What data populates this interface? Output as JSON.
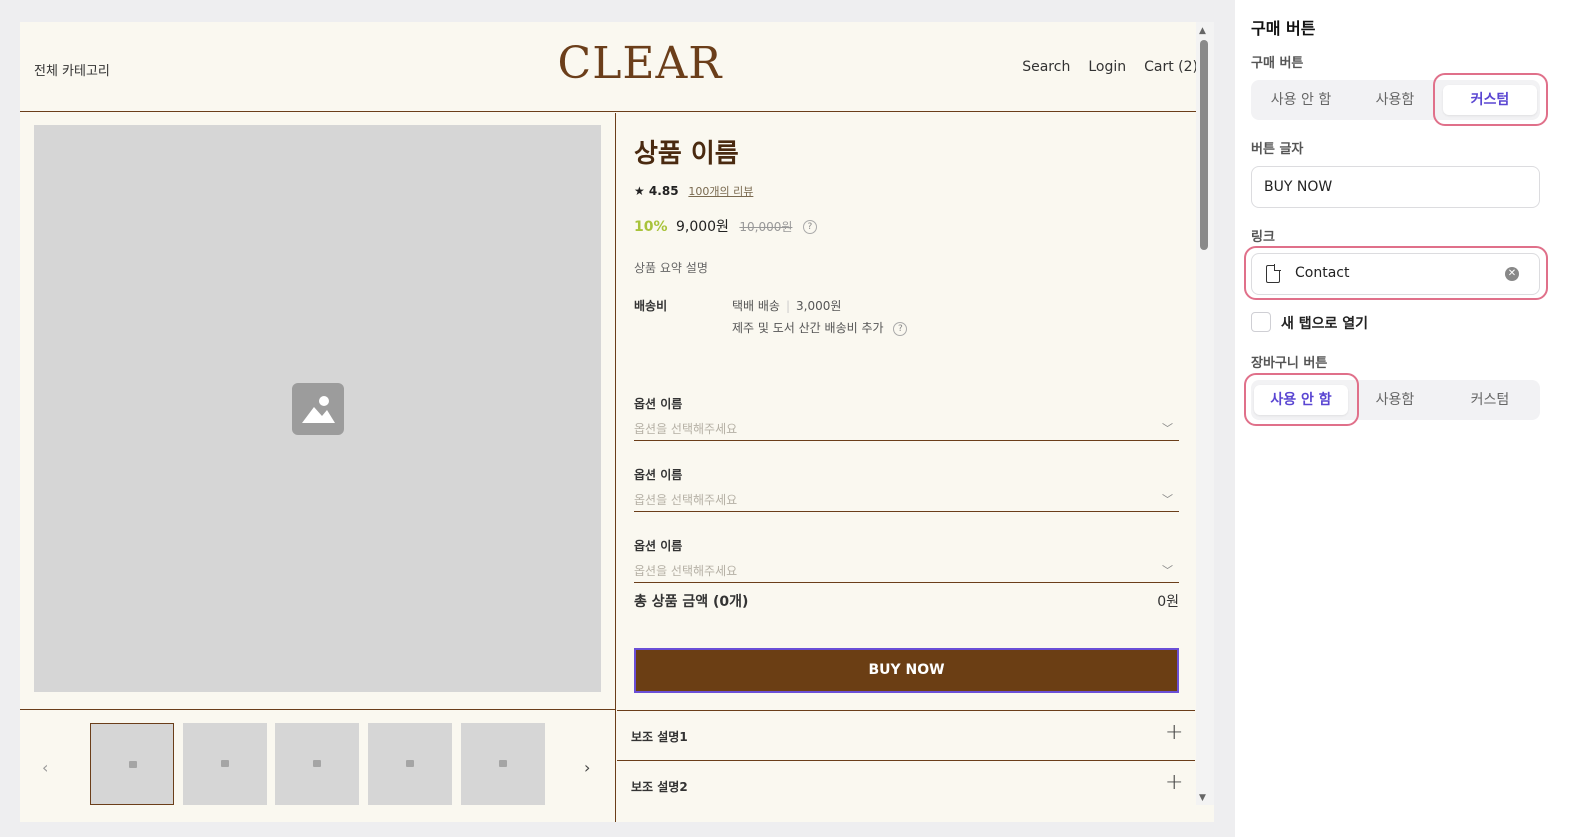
{
  "preview": {
    "header": {
      "category": "전체 카테고리",
      "logo": "CLEAR",
      "nav": [
        "Search",
        "Login",
        "Cart (2)"
      ]
    },
    "product": {
      "name": "상품 이름",
      "rating": "★ 4.85",
      "reviews": "100개의 리뷰",
      "discount": "10%",
      "price": "9,000원",
      "original_price": "10,000원",
      "summary": "상품 요약 설명",
      "shipping_label": "배송비",
      "shipping_method": "택배 배송",
      "shipping_fee": "3,000원",
      "shipping_extra": "제주 및 도서 산간 배송비 추가",
      "options": [
        {
          "label": "옵션 이름",
          "placeholder": "옵션을 선택해주세요"
        },
        {
          "label": "옵션 이름",
          "placeholder": "옵션을 선택해주세요"
        },
        {
          "label": "옵션 이름",
          "placeholder": "옵션을 선택해주세요"
        }
      ],
      "total_label": "총 상품 금액 (0개)",
      "total_value": "0원",
      "buy_button": "BUY NOW",
      "accordions": [
        "보조 설명1",
        "보조 설명2"
      ]
    }
  },
  "panel": {
    "title": "구매 버튼",
    "buy_button_label": "구매 버튼",
    "buy_button_options": [
      "사용 안 함",
      "사용함",
      "커스텀"
    ],
    "buy_button_selected": "커스텀",
    "button_text_label": "버튼 글자",
    "button_text_value": "BUY NOW",
    "link_label": "링크",
    "link_value": "Contact",
    "new_tab_label": "새 탭으로 열기",
    "new_tab_checked": false,
    "cart_button_label": "장바구니 버튼",
    "cart_button_options": [
      "사용 안 함",
      "사용함",
      "커스텀"
    ],
    "cart_button_selected": "사용 안 함"
  },
  "colors": {
    "brand_brown": "#6b3e14",
    "selected_purple": "#5a46d2",
    "highlight_pink": "#e0708a",
    "discount_green": "#a8c33a"
  }
}
